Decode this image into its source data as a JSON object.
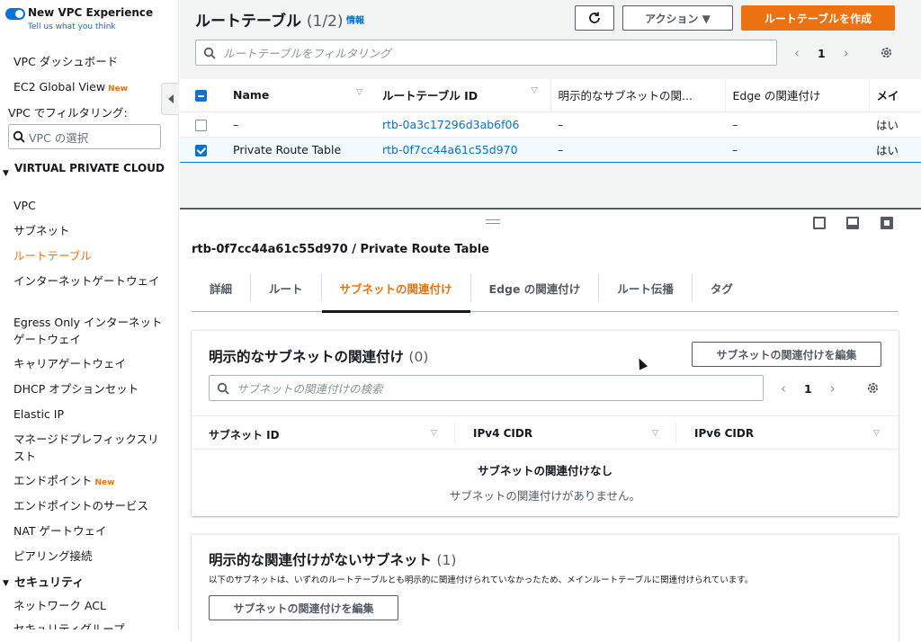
{
  "sidebar": {
    "brand_title": "New VPC Experience",
    "brand_sub": "Tell us what you think",
    "dashboard": "VPC ダッシュボード",
    "ec2_global": "EC2 Global View",
    "new_badge": "New",
    "filter_label": "VPC でフィルタリング:",
    "filter_placeholder": "VPC の選択",
    "section_vpc": "VIRTUAL PRIVATE CLOUD",
    "items": [
      "VPC",
      "サブネット",
      "ルートテーブル",
      "インターネットゲートウェイ",
      "Egress Only インターネットゲートウェイ",
      "キャリアゲートウェイ",
      "DHCP オプションセット",
      "Elastic IP",
      "マネージドプレフィックスリスト",
      "エンドポイント",
      "エンドポイントのサービス",
      "NAT ゲートウェイ",
      "ピアリング接続"
    ],
    "section_security": "セキュリティ",
    "security_items": [
      "ネットワーク ACL",
      "セキュリティグループ"
    ],
    "accent_color": "#ec7211"
  },
  "header": {
    "title": "ルートテーブル",
    "count": "(1/2)",
    "info": "情報",
    "refresh_icon": "refresh-icon",
    "actions_label": "アクション ▼",
    "create_label": "ルートテーブルを作成",
    "filter_placeholder": "ルートテーブルをフィルタリング",
    "page": "1"
  },
  "table": {
    "columns": [
      "Name",
      "ルートテーブル ID",
      "明示的なサブネットの関...",
      "Edge の関連付け",
      "メイ"
    ],
    "rows": [
      {
        "name": "–",
        "id": "rtb-0a3c17296d3ab6f06",
        "subnet": "–",
        "edge": "–",
        "main": "はい"
      },
      {
        "name": "Private Route Table",
        "id": "rtb-0f7cc44a61c55d970",
        "subnet": "–",
        "edge": "–",
        "main": "はい"
      }
    ]
  },
  "detail": {
    "title": "rtb-0f7cc44a61c55d970 / Private Route Table",
    "tabs": [
      "詳細",
      "ルート",
      "サブネットの関連付け",
      "Edge の関連付け",
      "ルート伝播",
      "タグ"
    ],
    "explicit": {
      "title": "明示的なサブネットの関連付け",
      "count": "(0)",
      "edit_label": "サブネットの関連付けを編集",
      "search_placeholder": "サブネットの関連付けの検索",
      "page": "1",
      "columns": [
        "サブネット ID",
        "IPv4 CIDR",
        "IPv6 CIDR"
      ],
      "empty_title": "サブネットの関連付けなし",
      "empty_desc": "サブネットの関連付けがありません。"
    },
    "implicit": {
      "title": "明示的な関連付けがないサブネット",
      "count": "(1)",
      "description": "以下のサブネットは、いずれのルートテーブルとも明示的に関連付けられていなかったため、メインルートテーブルに関連付けられています。",
      "edit_label": "サブネットの関連付けを編集"
    }
  }
}
